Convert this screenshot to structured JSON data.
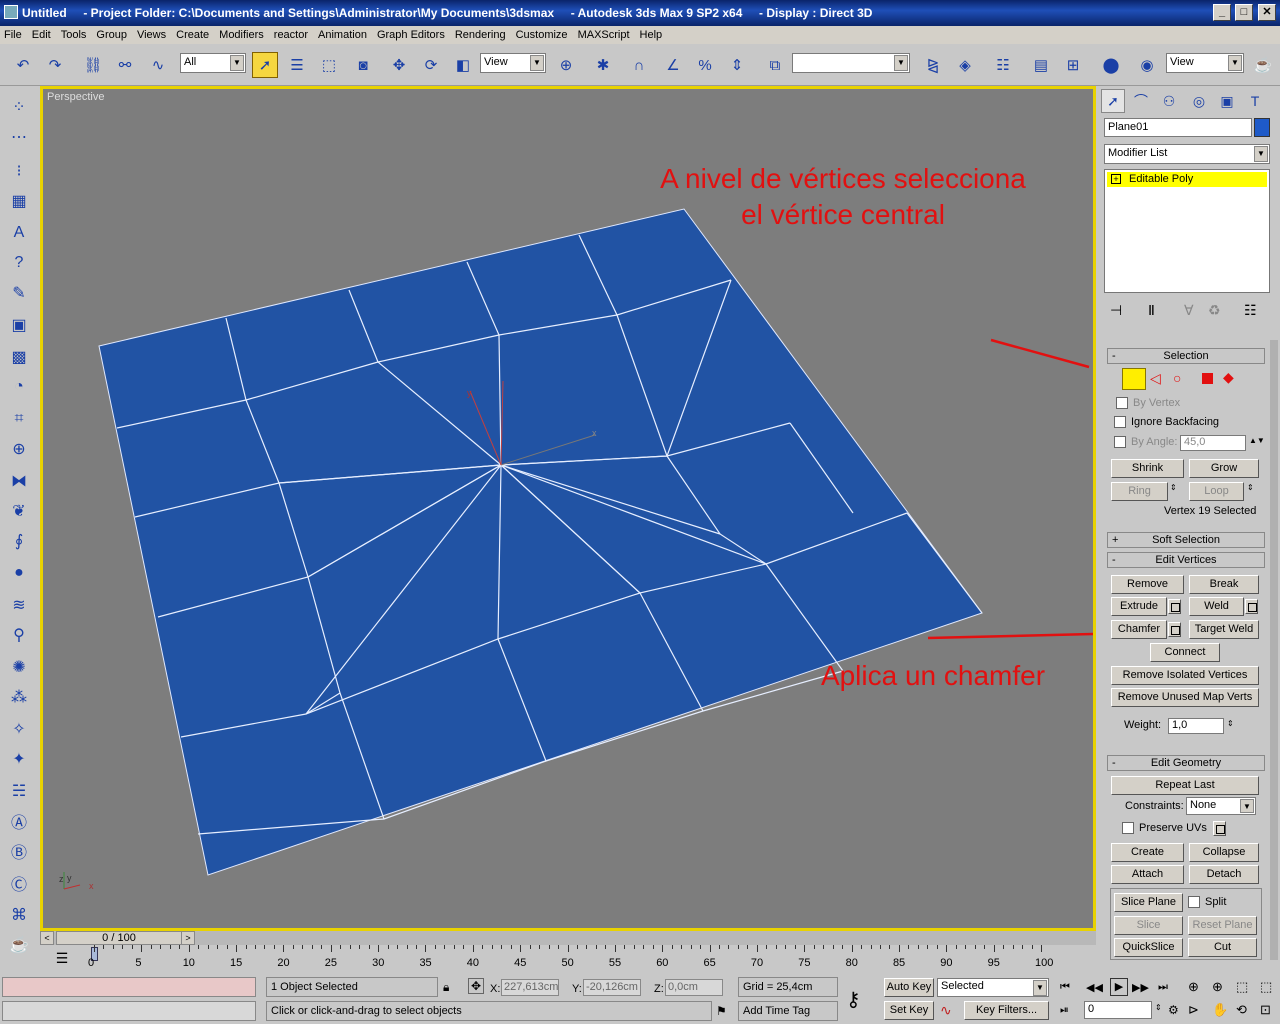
{
  "titlebar": {
    "title": "Untitled     - Project Folder: C:\\Documents and Settings\\Administrator\\My Documents\\3dsmax     - Autodesk 3ds Max 9 SP2 x64     - Display : Direct 3D",
    "min": "_",
    "max": "□",
    "close": "✕"
  },
  "menu": [
    "File",
    "Edit",
    "Tools",
    "Group",
    "Views",
    "Create",
    "Modifiers",
    "reactor",
    "Animation",
    "Graph Editors",
    "Rendering",
    "Customize",
    "MAXScript",
    "Help"
  ],
  "toolbar": {
    "selection_filter": "All",
    "ref_coord": "View",
    "named_selection": "",
    "view_dd": "View",
    "angle_snap_label": "3",
    "percent_label": "%"
  },
  "viewport": {
    "label": "Perspective",
    "axis_x": "x",
    "axis_y": "y",
    "axis_z": "z",
    "plane_color": "#2153a4"
  },
  "annotations": {
    "top": [
      "A nivel de vértices selecciona",
      "el vértice central"
    ],
    "bottom": "Aplica un chamfer",
    "color": "#e21010"
  },
  "command_panel": {
    "object_name": "Plane01",
    "object_color": "#1e5ac8",
    "modifier_list": "Modifier List",
    "stack_item": "Editable Poly",
    "selection": {
      "header": "Selection",
      "by_vertex": "By Vertex",
      "ignore_backfacing": "Ignore Backfacing",
      "by_angle": "By Angle:",
      "angle_value": "45,0",
      "shrink": "Shrink",
      "grow": "Grow",
      "ring": "Ring",
      "loop": "Loop",
      "status": "Vertex 19 Selected"
    },
    "soft_selection": "Soft Selection",
    "edit_vertices": {
      "header": "Edit Vertices",
      "remove": "Remove",
      "break": "Break",
      "extrude": "Extrude",
      "weld": "Weld",
      "chamfer": "Chamfer",
      "target_weld": "Target Weld",
      "connect": "Connect",
      "remove_isolated": "Remove Isolated Vertices",
      "remove_unused": "Remove Unused Map Verts",
      "weight_label": "Weight:",
      "weight_value": "1,0"
    },
    "edit_geometry": {
      "header": "Edit Geometry",
      "repeat_last": "Repeat Last",
      "constraints_label": "Constraints:",
      "constraints_value": "None",
      "preserve_uvs": "Preserve UVs",
      "create": "Create",
      "collapse": "Collapse",
      "attach": "Attach",
      "detach": "Detach",
      "slice_plane": "Slice Plane",
      "split": "Split",
      "slice": "Slice",
      "reset_plane": "Reset Plane",
      "quickslice": "QuickSlice",
      "cut": "Cut"
    }
  },
  "timeline": {
    "frame": "0 / 100",
    "ticks": [
      "0",
      "5",
      "10",
      "15",
      "20",
      "25",
      "30",
      "35",
      "40",
      "45",
      "50",
      "55",
      "60",
      "65",
      "70",
      "75",
      "80",
      "85",
      "90",
      "95",
      "100"
    ]
  },
  "status": {
    "selected": "1 Object Selected",
    "prompt": "Click or click-and-drag to select objects",
    "x_label": "X:",
    "x_value": "227,613cm",
    "y_label": "Y:",
    "y_value": "-20,126cm",
    "z_label": "Z:",
    "z_value": "0,0cm",
    "grid": "Grid = 25,4cm",
    "add_time_tag": "Add Time Tag",
    "auto_key": "Auto Key",
    "set_key": "Set Key",
    "key_mode": "Selected",
    "key_filters": "Key Filters...",
    "current_frame": "0"
  }
}
